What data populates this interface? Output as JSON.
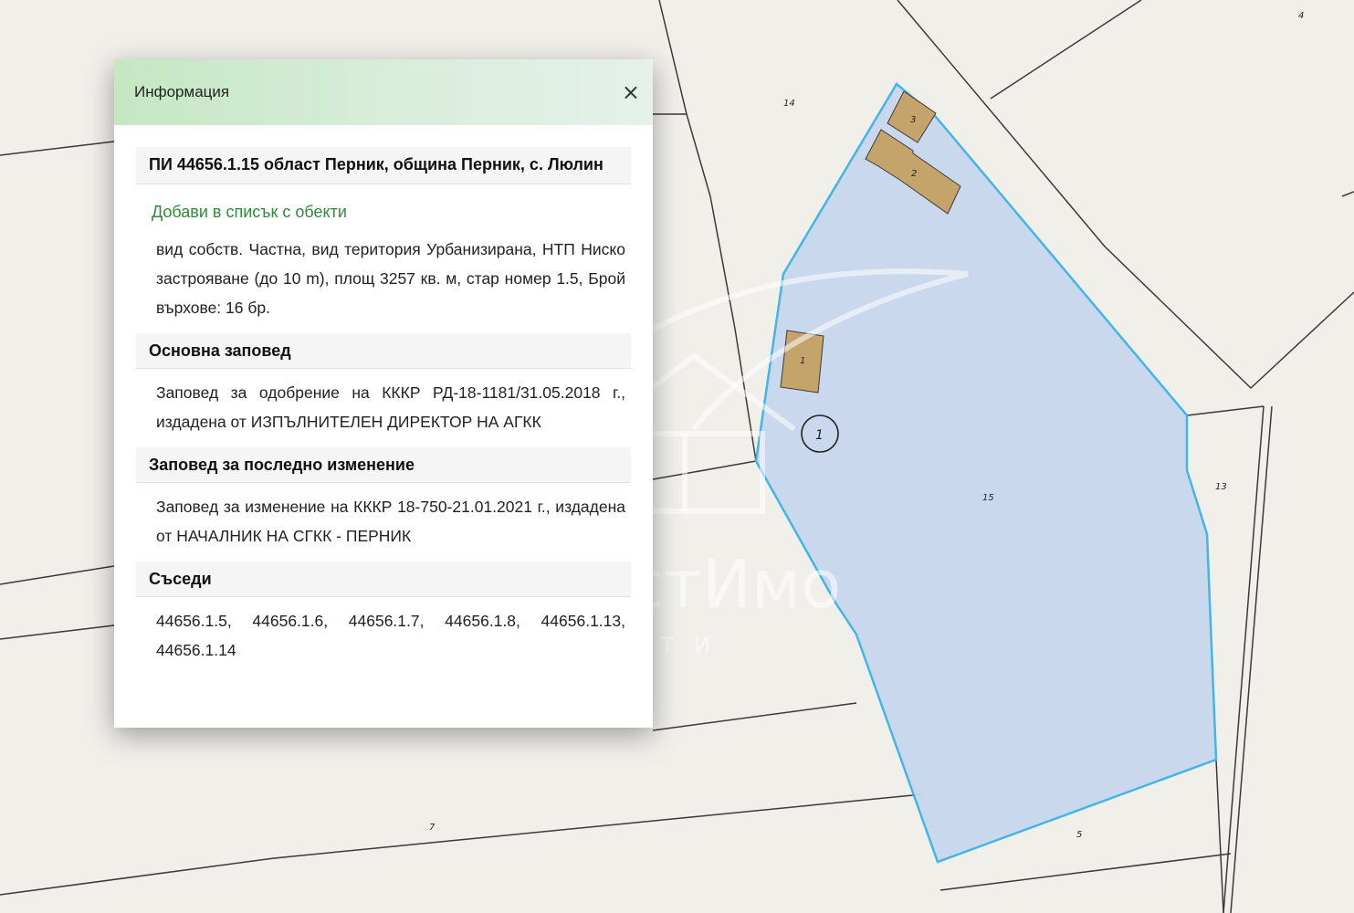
{
  "panel": {
    "title": "Информация",
    "close_label": "×",
    "property_heading": "ПИ 44656.1.15 област Перник, община Перник, с. Люлин",
    "add_link": "Добави в списък с обекти",
    "property_details": "вид собств. Частна, вид територия Урбанизирана, НТП Ниско застрояване (до 10 m), площ 3257 кв. м, стар номер 1.5, Брой върхове: 16 бр.",
    "main_order": {
      "heading": "Основна заповед",
      "text": "Заповед за одобрение на КККР РД-18-1181/31.05.2018 г., издадена от ИЗПЪЛНИТЕЛЕН ДИРЕКТОР НА АГКК"
    },
    "last_change_order": {
      "heading": "Заповед за последно изменение",
      "text": "Заповед за изменение на КККР 18-750-21.01.2021 г., издадена от НАЧАЛНИК НА СГКК - ПЕРНИК"
    },
    "neighbours": {
      "heading": "Съседи",
      "text": "44656.1.5, 44656.1.6, 44656.1.7, 44656.1.8, 44656.1.13, 44656.1.14"
    }
  },
  "map": {
    "parcel_labels": {
      "p4": "4",
      "p14": "14",
      "p15": "15",
      "p13": "13",
      "p7": "7",
      "p5": "5"
    },
    "building_labels": {
      "b1": "1",
      "b2": "2",
      "b3": "3"
    },
    "marker_label": "1",
    "colors": {
      "background": "#f1efea",
      "selected_fill": "#c7d7ee",
      "selected_outline": "#3bb3e6",
      "building_fill": "#c4a46b",
      "line": "#3a3a3a"
    }
  },
  "watermark": {
    "brand": "ИнвестИмо",
    "sub": "ИМОТИ"
  }
}
